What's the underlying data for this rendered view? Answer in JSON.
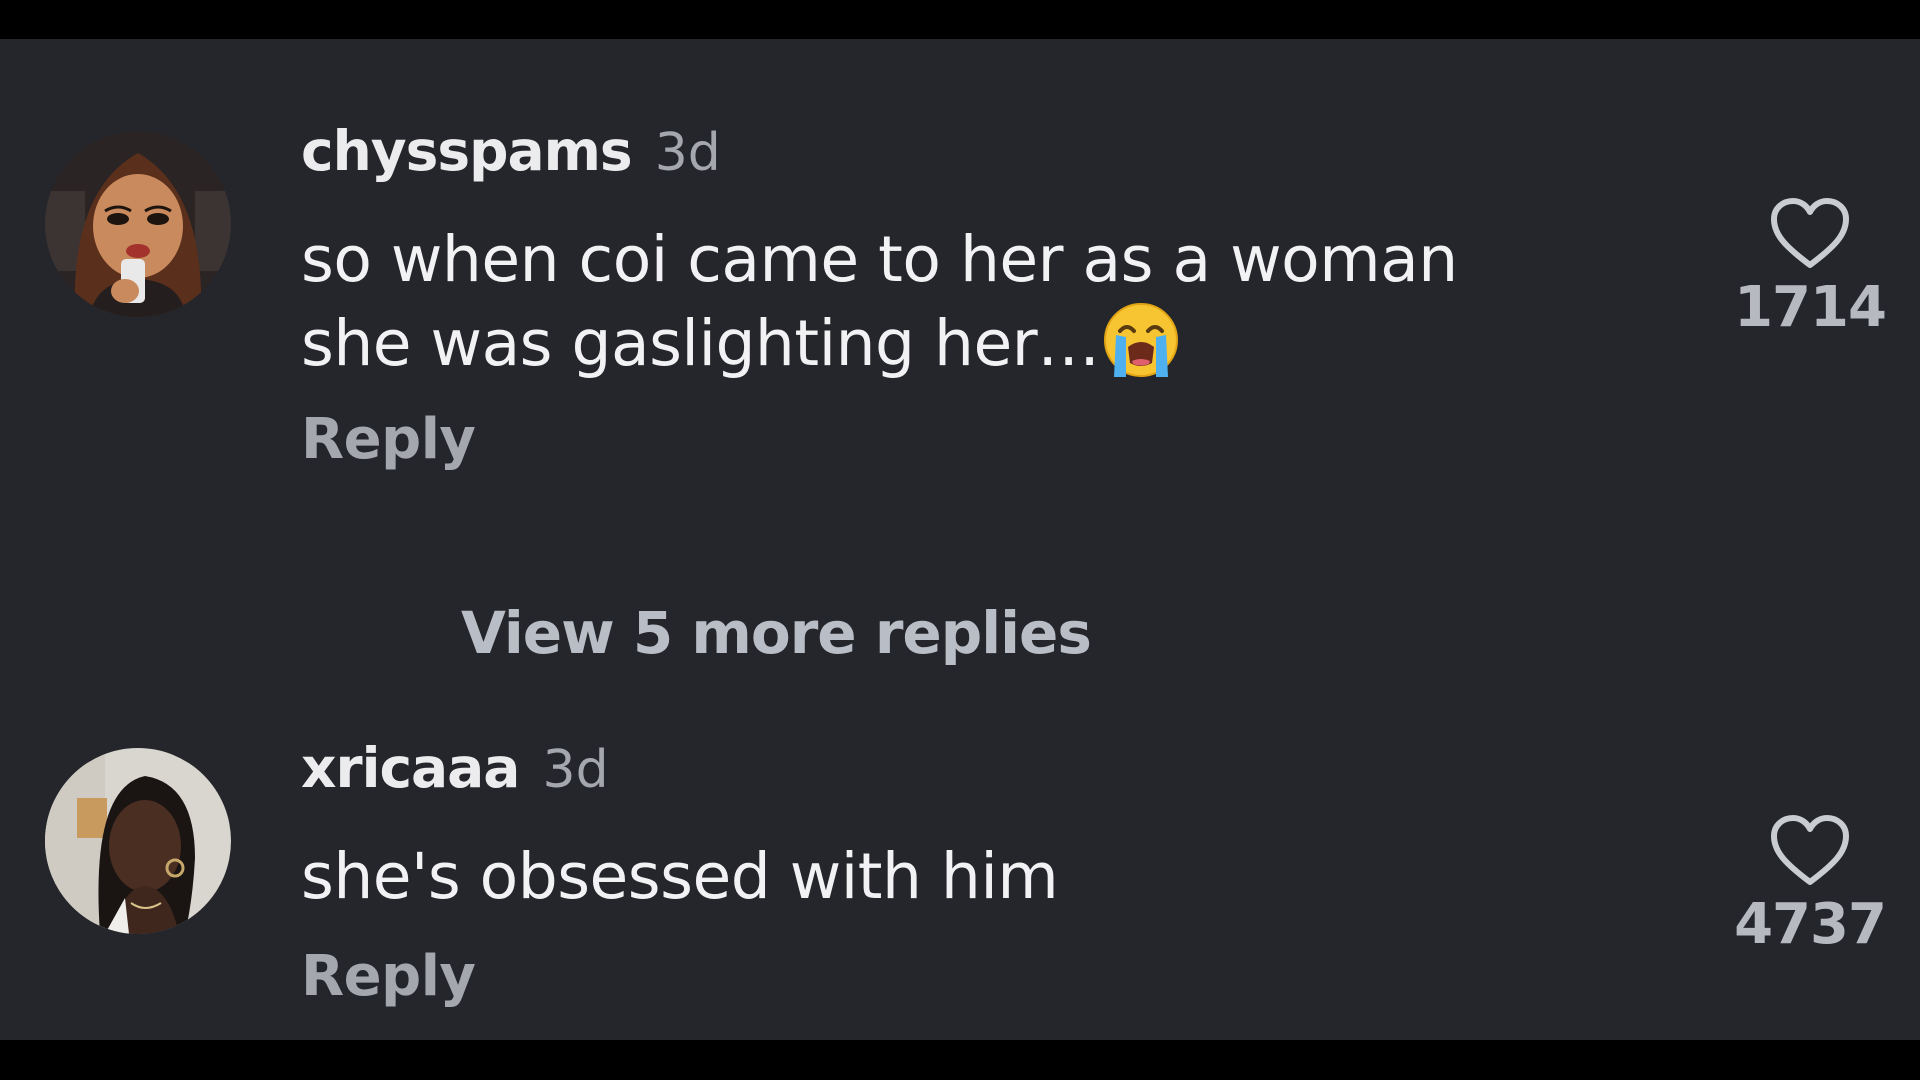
{
  "colors": {
    "background": "#24262b",
    "letterbox": "#000000",
    "username": "#ececee",
    "body_text": "#f2f2f4",
    "muted_text": "#a4a7ad",
    "view_replies": "#b9bdc6"
  },
  "comments": [
    {
      "username": "chysspams",
      "time": "3d",
      "text_lines": [
        "so when coi came to her as a woman",
        "she was gaslighting her…"
      ],
      "emoji": "loudly-crying-face",
      "reply_label": "Reply",
      "like_icon": "heart-outline-icon",
      "like_count": "1714"
    },
    {
      "username": "xricaaa",
      "time": "3d",
      "text_lines": [
        "she's obsessed with him"
      ],
      "reply_label": "Reply",
      "like_icon": "heart-outline-icon",
      "like_count": "4737"
    }
  ],
  "view_more_replies": "View 5 more replies"
}
